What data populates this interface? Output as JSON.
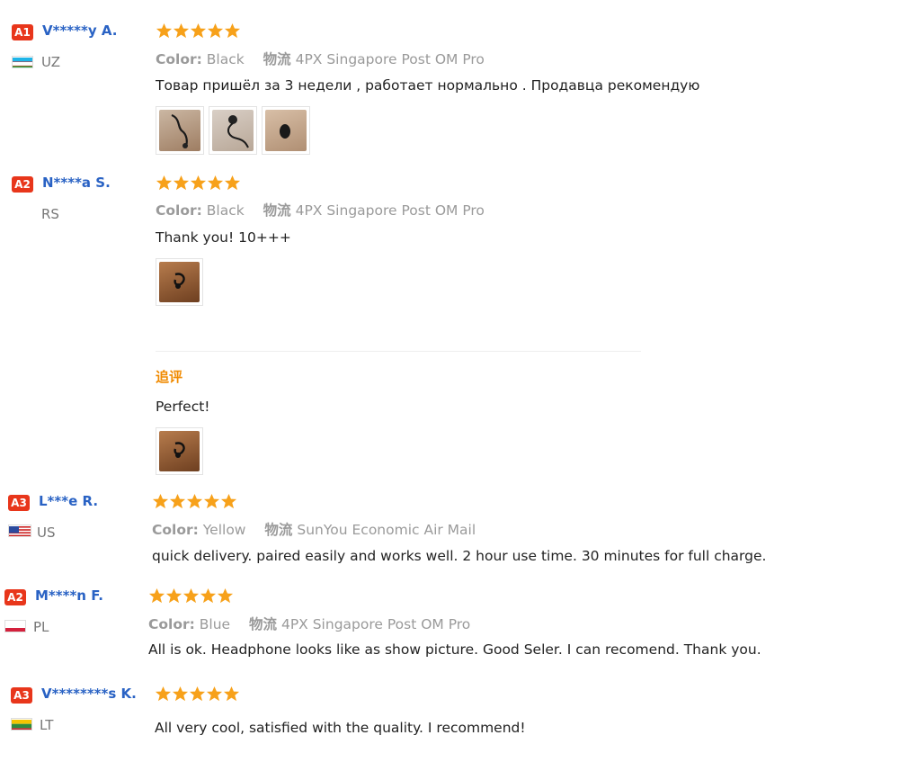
{
  "reviews": [
    {
      "badge": "A1",
      "name": "V*****y A.",
      "country": "UZ",
      "flag": "flag-uz",
      "rating": 5,
      "color_label": "Color:",
      "color_value": "Black",
      "ship_label": "物流",
      "ship_value": "4PX Singapore Post OM Pro",
      "text": "Товар пришёл за 3 недели , работает нормально . Продавца рекомендую"
    },
    {
      "badge": "A2",
      "name": "N****a S.",
      "country": "RS",
      "flag": "none",
      "rating": 5,
      "color_label": "Color:",
      "color_value": "Black",
      "ship_label": "物流",
      "ship_value": "4PX Singapore Post OM Pro",
      "text": "Thank you! 10+++",
      "followup_label": "追评",
      "followup_text": "Perfect!"
    },
    {
      "badge": "A3",
      "name": "L***e R.",
      "country": "US",
      "flag": "flag-us",
      "rating": 5,
      "color_label": "Color:",
      "color_value": "Yellow",
      "ship_label": "物流",
      "ship_value": "SunYou Economic Air Mail",
      "text": "quick delivery. paired easily and works well. 2 hour use time. 30 minutes for full charge."
    },
    {
      "badge": "A2",
      "name": "M****n F.",
      "country": "PL",
      "flag": "flag-pl",
      "rating": 5,
      "color_label": "Color:",
      "color_value": "Blue",
      "ship_label": "物流",
      "ship_value": "4PX Singapore Post OM Pro",
      "text": "All is ok. Headphone looks like as show picture. Good Seler. I can recomend. Thank you."
    },
    {
      "badge": "A3",
      "name": "V********s K.",
      "country": "LT",
      "flag": "flag-lt",
      "rating": 5,
      "text": "All very cool, satisfied with the quality. I recommend!"
    }
  ],
  "colors": {
    "star": "#f7a11a",
    "badge": "#e8361b",
    "name": "#2962c4",
    "followup": "#f08a00"
  }
}
